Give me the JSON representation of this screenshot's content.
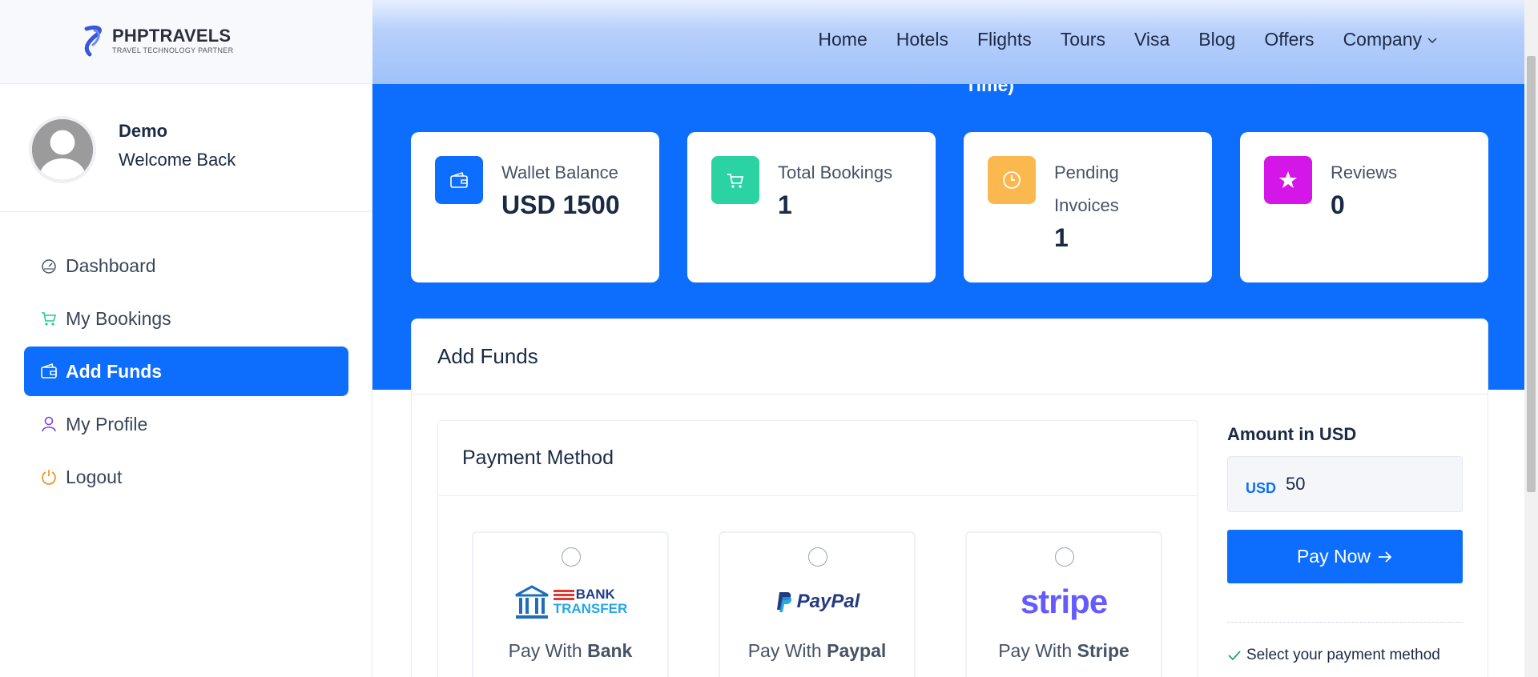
{
  "header": {
    "brand": "PHPTRAVELS",
    "tagline": "TRAVEL TECHNOLOGY PARTNER",
    "nav": [
      "Home",
      "Hotels",
      "Flights",
      "Tours",
      "Visa",
      "Blog",
      "Offers",
      "Company"
    ]
  },
  "sidebar": {
    "user_name": "Demo",
    "welcome": "Welcome Back",
    "items": [
      {
        "label": "Dashboard",
        "icon": "dashboard-icon",
        "color": "#475266"
      },
      {
        "label": "My Bookings",
        "icon": "cart-icon",
        "color": "#1fc99a"
      },
      {
        "label": "Add Funds",
        "icon": "wallet-icon",
        "color": "#ffffff"
      },
      {
        "label": "My Profile",
        "icon": "user-icon",
        "color": "#7b3fe4"
      },
      {
        "label": "Logout",
        "icon": "power-icon",
        "color": "#f08c1a"
      }
    ],
    "active_index": 2
  },
  "banner": {
    "title_fragment": "Time)"
  },
  "stats": [
    {
      "label": "Wallet Balance",
      "value": "USD 1500",
      "icon": "wallet-icon",
      "color": "#0d6efd"
    },
    {
      "label": "Total Bookings",
      "value": "1",
      "icon": "cart-icon",
      "color": "#2bd3a2"
    },
    {
      "label": "Pending Invoices",
      "value": "1",
      "icon": "clock-icon",
      "color": "#fbb84f"
    },
    {
      "label": "Reviews",
      "value": "0",
      "icon": "star-icon",
      "color": "#d516e8"
    }
  ],
  "add_funds": {
    "title": "Add Funds",
    "payment_method_title": "Payment Method",
    "methods": [
      {
        "prefix": "Pay With ",
        "name": "Bank",
        "logo_top": "BANK",
        "logo_bottom": "TRANSFER"
      },
      {
        "prefix": "Pay With ",
        "name": "Paypal",
        "logo_text": "PayPal"
      },
      {
        "prefix": "Pay With ",
        "name": "Stripe",
        "logo_text": "stripe"
      }
    ],
    "amount_label": "Amount in USD",
    "currency": "USD",
    "amount_value": "50",
    "pay_button": "Pay Now",
    "note": "Select your payment method"
  },
  "colors": {
    "accent": "#0d6efd"
  }
}
